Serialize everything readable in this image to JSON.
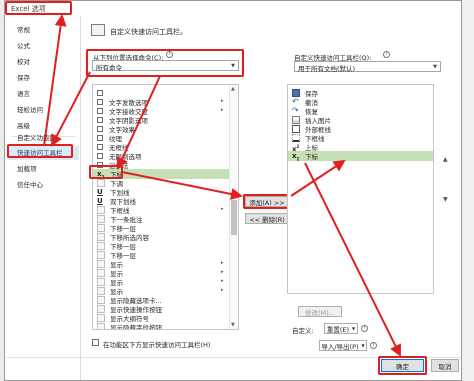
{
  "window": {
    "title": "Excel 选项",
    "bg_stripe": "#e8e8e8"
  },
  "sidebar": {
    "items": [
      {
        "label": "常规"
      },
      {
        "label": "公式"
      },
      {
        "label": "校对"
      },
      {
        "label": "保存"
      },
      {
        "label": "语言"
      },
      {
        "label": "轻松访问"
      },
      {
        "label": "高级"
      },
      {
        "label": "自定义功能区"
      },
      {
        "label": "快速访问工具栏"
      },
      {
        "label": "加载项"
      },
      {
        "label": "信任中心"
      }
    ],
    "selected_index": 8
  },
  "header": {
    "title": "自定义快速访问工具栏。"
  },
  "left": {
    "choose_label": "从下列位置选择命令(C):",
    "choose_value": "所有命令",
    "items": [
      {
        "icon": "checkbox",
        "label": ""
      },
      {
        "icon": "checkbox",
        "label": "文字发散选项"
      },
      {
        "icon": "checkbox",
        "label": "文字接收交度"
      },
      {
        "icon": "checkbox",
        "label": "文字阴影选项"
      },
      {
        "icon": "checkbox",
        "label": "文字效果"
      },
      {
        "icon": "checkbox",
        "label": "纹理"
      },
      {
        "icon": "checkbox",
        "label": "无框线"
      },
      {
        "icon": "checkbox",
        "label": "无限制选项"
      },
      {
        "icon": "checkbox",
        "label": "迷数法"
      },
      {
        "icon": "subscript",
        "label": "下标"
      },
      {
        "icon": "blank",
        "label": "下调"
      },
      {
        "icon": "underline",
        "label": "下划线"
      },
      {
        "icon": "underline2",
        "label": "双下划线"
      },
      {
        "icon": "blank",
        "label": "下框线"
      },
      {
        "icon": "blank",
        "label": "下一条批注"
      },
      {
        "icon": "blank",
        "label": "下移一层"
      },
      {
        "icon": "blank",
        "label": "下移所选内容"
      },
      {
        "icon": "blank",
        "label": "下移一层"
      },
      {
        "icon": "blank",
        "label": "下移一层"
      },
      {
        "icon": "blank",
        "label": "显示"
      },
      {
        "icon": "blank",
        "label": "显示"
      },
      {
        "icon": "blank",
        "label": "显示"
      },
      {
        "icon": "blank",
        "label": "显示"
      },
      {
        "icon": "blank",
        "label": "显示隐藏选项卡..."
      },
      {
        "icon": "blank",
        "label": "显示快速操作按钮"
      },
      {
        "icon": "blank",
        "label": "显示大纲符号"
      },
      {
        "icon": "blank",
        "label": "显示隐藏字段按钮"
      }
    ],
    "selected_index": 9
  },
  "middle": {
    "add_label": "添加(A) >>",
    "remove_label": "<< 删除(R)"
  },
  "right": {
    "customize_label": "自定义快速访问工具栏(Q):",
    "customize_value": "用于所有文档(默认)",
    "items": [
      {
        "icon": "save",
        "label": "保存"
      },
      {
        "icon": "undo",
        "label": "撤消"
      },
      {
        "icon": "redo",
        "label": "恢复"
      },
      {
        "icon": "table",
        "label": "插入图片"
      },
      {
        "icon": "table2",
        "label": "外部框线"
      },
      {
        "icon": "border",
        "label": "下框线"
      },
      {
        "icon": "superscript",
        "label": "上标"
      },
      {
        "icon": "subscript",
        "label": "下标"
      }
    ],
    "selected_index": 7,
    "modify_label": "修改(M)...",
    "custom_label": "自定义:",
    "reset_label": "重置(E)",
    "import_label": "导入/导出(P)"
  },
  "bottom": {
    "show_below_label": "在功能区下方显示快速访问工具栏(H)",
    "ok_label": "确定",
    "cancel_label": "取消"
  },
  "colors": {
    "accent_red": "#e02020",
    "selected_green": "#c5e0b4",
    "sidebar_selected": "#dfe9f5"
  }
}
